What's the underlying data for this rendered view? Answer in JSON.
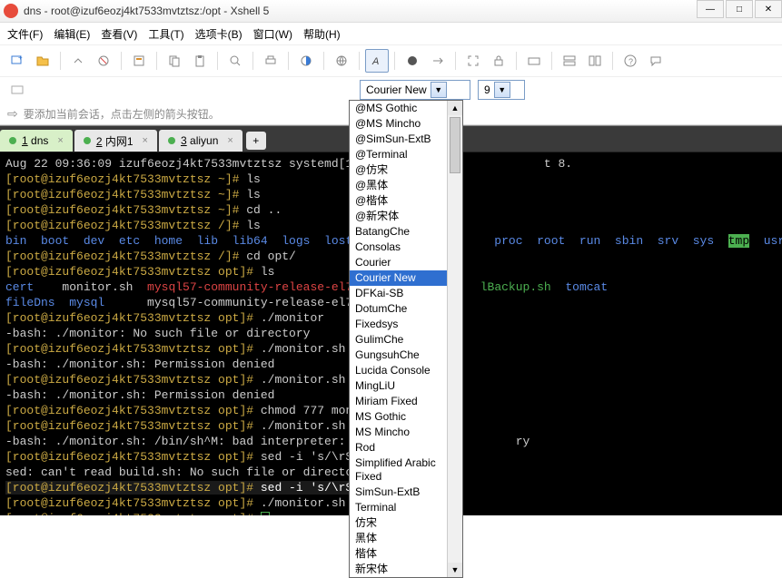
{
  "window": {
    "title": "dns - root@izuf6eozj4kt7533mvtztsz:/opt - Xshell 5"
  },
  "winctrl": {
    "min": "—",
    "max": "□",
    "close": "✕"
  },
  "menu": {
    "file": "文件(F)",
    "edit": "编辑(E)",
    "view": "查看(V)",
    "tools": "工具(T)",
    "tabs": "选项卡(B)",
    "window": "窗口(W)",
    "help": "帮助(H)"
  },
  "font": {
    "name": "Courier New",
    "size": "9"
  },
  "fontlist": [
    "@MS Gothic",
    "@MS Mincho",
    "@SimSun-ExtB",
    "@Terminal",
    "@仿宋",
    "@黑体",
    "@楷体",
    "@新宋体",
    "BatangChe",
    "Consolas",
    "Courier",
    "Courier New",
    "DFKai-SB",
    "DotumChe",
    "Fixedsys",
    "GulimChe",
    "GungsuhChe",
    "Lucida Console",
    "MingLiU",
    "Miriam Fixed",
    "MS Gothic",
    "MS Mincho",
    "Rod",
    "Simplified Arabic Fixed",
    "SimSun-ExtB",
    "Terminal",
    "仿宋",
    "黑体",
    "楷体",
    "新宋体"
  ],
  "hint": {
    "text": "要添加当前会话，点击左侧的箭头按钮。"
  },
  "tabs": [
    {
      "n": "1",
      "label": "dns",
      "active": true
    },
    {
      "n": "2",
      "label": "内网1",
      "active": false
    },
    {
      "n": "3",
      "label": "aliyun",
      "active": false
    }
  ],
  "term": {
    "l0a": "Aug 22 09:36:09 izuf6eozj4kt7533mvtztsz systemd[1]: S",
    "l0b": "t 8.",
    "l1p": "[root@izuf6eozj4kt7533mvtztsz ~]#",
    "l1c": " ls",
    "l2p": "[root@izuf6eozj4kt7533mvtztsz ~]#",
    "l2c": " ls",
    "l3p": "[root@izuf6eozj4kt7533mvtztsz ~]#",
    "l3c": " cd ..",
    "l4p": "[root@izuf6eozj4kt7533mvtztsz /]#",
    "l4c": " ls",
    "dirs1": "bin  boot  dev  etc  home  lib  lib64  logs  lost+fou",
    "dirs1b": "  proc  root  run  sbin  srv  sys  ",
    "dirs1c": "  usr  var",
    "tmp": "tmp",
    "l5p": "[root@izuf6eozj4kt7533mvtztsz /]#",
    "l5c": " cd opt/",
    "l6p": "[root@izuf6eozj4kt7533mvtztsz opt]#",
    "l6c": " ls",
    "cert": "cert",
    "mon": "    monitor.sh  ",
    "pkg1": "mysql57-community-release-el7-11.",
    "bk": "lBackup.sh  ",
    "tom": "tomcat",
    "fdns": "fileDns  mysql",
    "pkg2": "      mysql57-community-release-el7-11.",
    "l7p": "[root@izuf6eozj4kt7533mvtztsz opt]#",
    "l7c": " ./monitor",
    "e1": "-bash: ./monitor: No such file or directory",
    "l8p": "[root@izuf6eozj4kt7533mvtztsz opt]#",
    "l8c": " ./monitor.sh",
    "e2": "-bash: ./monitor.sh: Permission denied",
    "l9p": "[root@izuf6eozj4kt7533mvtztsz opt]#",
    "l9c": " ./monitor.sh",
    "e3": "-bash: ./monitor.sh: Permission denied",
    "l10p": "[root@izuf6eozj4kt7533mvtztsz opt]#",
    "l10c": " chmod 777 monitor.",
    "l11p": "[root@izuf6eozj4kt7533mvtztsz opt]#",
    "l11c": " ./monitor.sh",
    "e4a": "-bash: ./monitor.sh: /bin/sh^M: bad interpreter: No su",
    "e4b": "ry",
    "l12p": "[root@izuf6eozj4kt7533mvtztsz opt]#",
    "l12c": " sed -i 's/\\r$//'",
    "e5": "sed: can't read build.sh: No such file or directory",
    "l13p": "[root@izuf6eozj4kt7533mvtztsz opt]#",
    "l13c": " sed -i 's/\\r$//' monitor.sh",
    "l14p": "[root@izuf6eozj4kt7533mvtztsz opt]#",
    "l14c": " ./monitor.sh",
    "l15p": "[root@izuf6eozj4kt7533mvtztsz opt]#",
    "l15c": " "
  }
}
